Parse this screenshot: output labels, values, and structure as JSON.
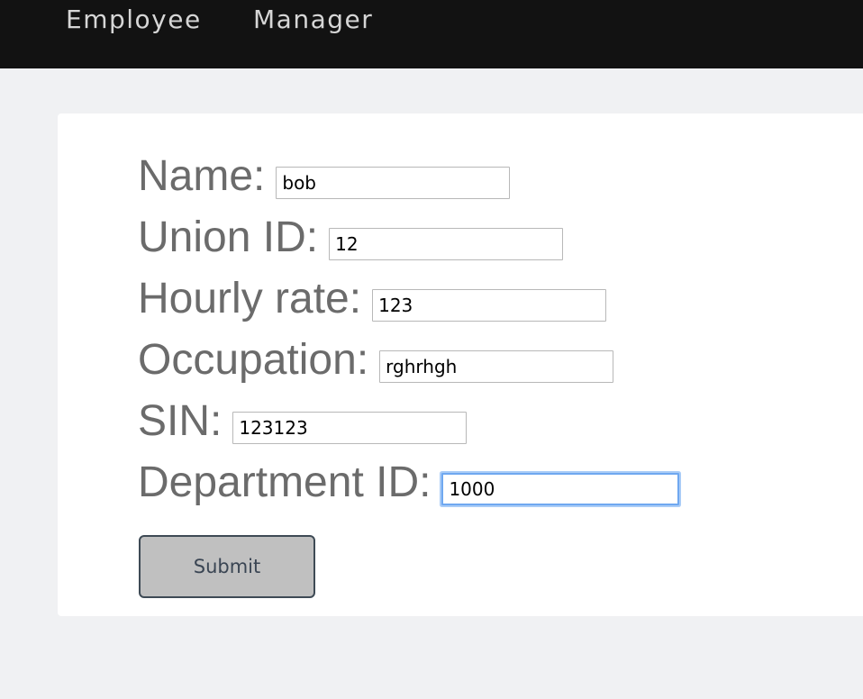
{
  "nav": {
    "employee_label": "Employee",
    "manager_label": "Manager"
  },
  "form": {
    "fields": [
      {
        "label": "Name:",
        "value": "bob"
      },
      {
        "label": "Union ID:",
        "value": "12"
      },
      {
        "label": "Hourly rate:",
        "value": "123"
      },
      {
        "label": "Occupation:",
        "value": "rghrhgh"
      },
      {
        "label": "SIN:",
        "value": "123123"
      },
      {
        "label": "Department ID:",
        "value": "1000",
        "focused": true
      }
    ],
    "submit_label": "Submit"
  },
  "colors": {
    "navbar_bg": "#121212",
    "page_bg": "#f0f1f3",
    "label_text": "#6b6b6b",
    "focus_ring": "#6fa8f0",
    "button_bg": "#c0c0c0"
  }
}
